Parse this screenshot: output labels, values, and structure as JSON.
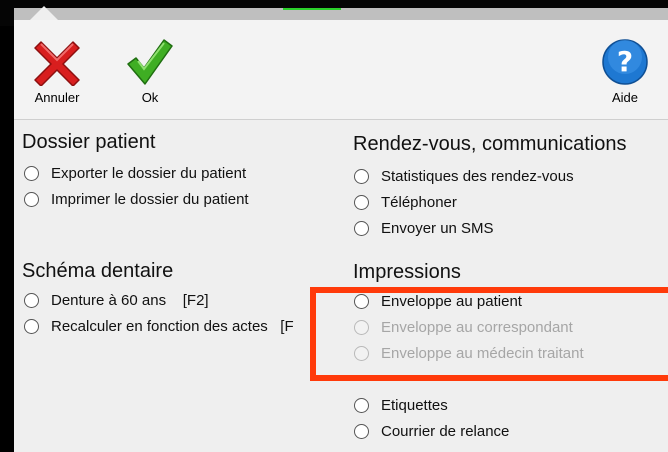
{
  "toolbar": {
    "cancel_label": "Annuler",
    "ok_label": "Ok",
    "help_label": "Aide"
  },
  "icons": {
    "cancel": "red-x-icon",
    "ok": "green-check-icon",
    "help": "question-mark-icon"
  },
  "colors": {
    "cancel_red": "#d81e1e",
    "ok_green": "#3fae23",
    "help_blue": "#1e78d2",
    "highlight": "#ff3a0a",
    "disabled_text": "#a6a6a6"
  },
  "sections": {
    "dossier": {
      "title": "Dossier patient",
      "options": [
        "Exporter le dossier du patient",
        "Imprimer le dossier du patient"
      ]
    },
    "schema": {
      "title": "Schéma dentaire",
      "options": [
        "Denture à 60 ans    [F2]",
        "Recalculer en fonction des actes   [F"
      ]
    },
    "rdv": {
      "title": "Rendez-vous, communications",
      "options": [
        "Statistiques des rendez-vous",
        "Téléphoner",
        "Envoyer un SMS"
      ]
    },
    "impressions": {
      "title": "Impressions",
      "options": [
        {
          "label": "Enveloppe au patient",
          "enabled": true
        },
        {
          "label": "Enveloppe au correspondant",
          "enabled": false
        },
        {
          "label": "Enveloppe au médecin traitant",
          "enabled": false
        },
        {
          "label": "Etiquettes",
          "enabled": true
        },
        {
          "label": "Courrier de relance",
          "enabled": true
        }
      ]
    }
  }
}
